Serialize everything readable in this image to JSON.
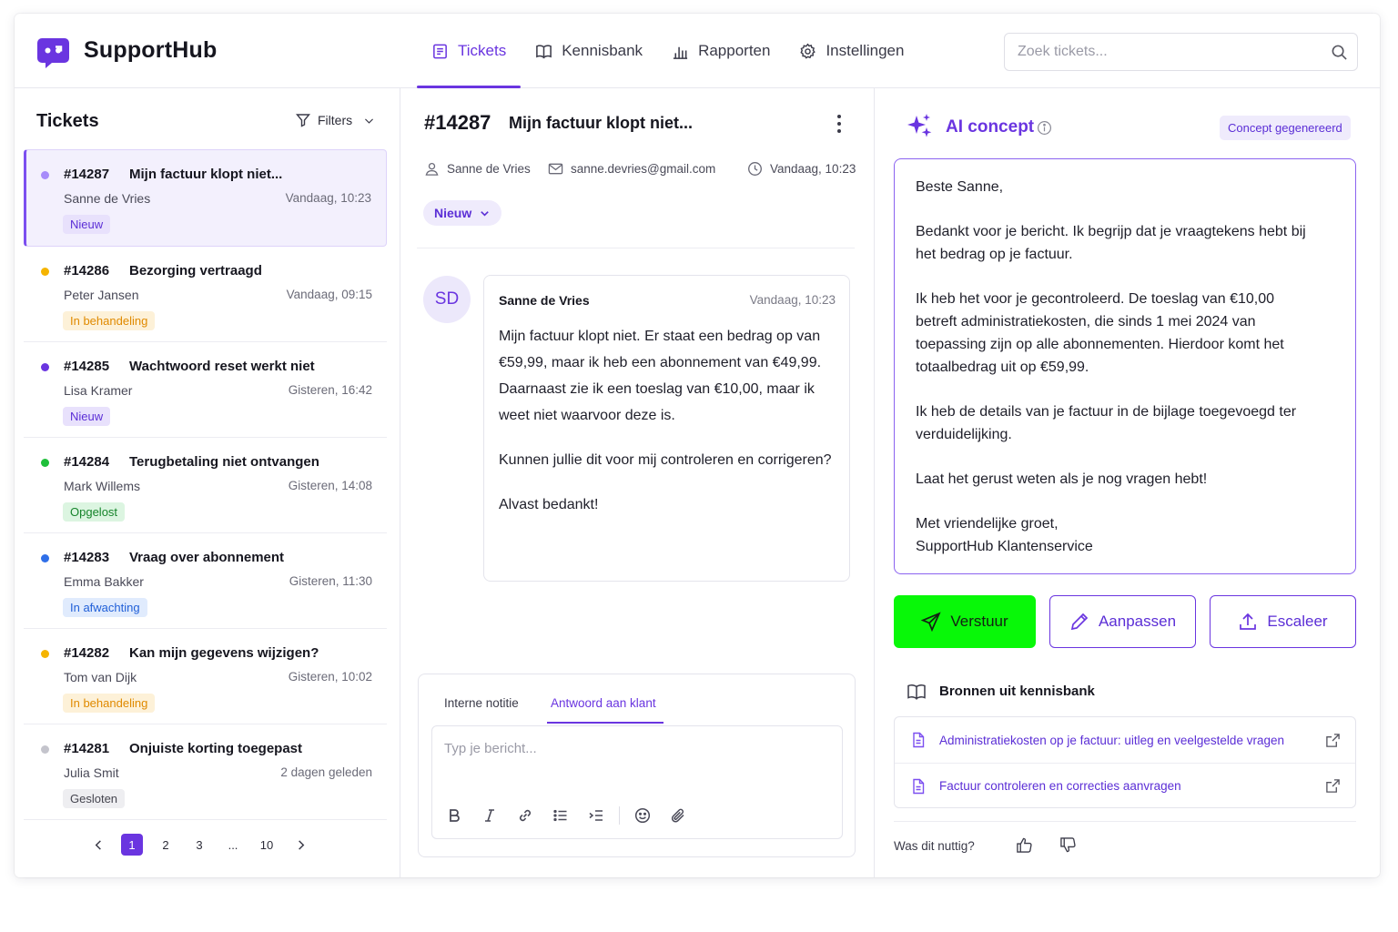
{
  "app": {
    "brand": "SupportHub"
  },
  "nav": {
    "items": [
      {
        "label": "Tickets",
        "icon": "ticket-icon",
        "active": true
      },
      {
        "label": "Kennisbank",
        "icon": "book-icon"
      },
      {
        "label": "Rapporten",
        "icon": "bar-chart-icon"
      },
      {
        "label": "Instellingen",
        "icon": "gear-icon"
      }
    ]
  },
  "search": {
    "placeholder": "Zoek tickets..."
  },
  "ticket_list": {
    "title": "Tickets",
    "filters_label": "Filters",
    "tickets": [
      {
        "id": "#14287",
        "title": "Mijn factuur klopt niet...",
        "name": "Sanne de Vries",
        "time": "Vandaag, 10:23",
        "status": "Nieuw",
        "dot": "#a78bfa",
        "badge_bg": "#e8e1fc",
        "badge_fg": "#5b2ed6"
      },
      {
        "id": "#14286",
        "title": "Bezorging vertraagd",
        "name": "Peter Jansen",
        "time": "Vandaag, 09:15",
        "status": "In behandeling",
        "dot": "#f5b400",
        "badge_bg": "#fdf1d8",
        "badge_fg": "#e08a00"
      },
      {
        "id": "#14285",
        "title": "Wachtwoord reset werkt niet",
        "name": "Lisa Kramer",
        "time": "Gisteren, 16:42",
        "status": "Nieuw",
        "dot": "#6a35e0",
        "badge_bg": "#e8e1fc",
        "badge_fg": "#5b2ed6"
      },
      {
        "id": "#14284",
        "title": "Terugbetaling niet ontvangen",
        "name": "Mark Willems",
        "time": "Gisteren, 14:08",
        "status": "Opgelost",
        "dot": "#1fbf3a",
        "badge_bg": "#dcf5e1",
        "badge_fg": "#16842b"
      },
      {
        "id": "#14283",
        "title": "Vraag over abonnement",
        "name": "Emma Bakker",
        "time": "Gisteren, 11:30",
        "status": "In afwachting",
        "dot": "#2f6fe8",
        "badge_bg": "#e0ebfd",
        "badge_fg": "#2160d8"
      },
      {
        "id": "#14282",
        "title": "Kan mijn gegevens wijzigen?",
        "name": "Tom van Dijk",
        "time": "Gisteren, 10:02",
        "status": "In behandeling",
        "dot": "#f5b400",
        "badge_bg": "#fdf1d8",
        "badge_fg": "#e08a00"
      },
      {
        "id": "#14281",
        "title": "Onjuiste korting toegepast",
        "name": "Julia Smit",
        "time": "2 dagen geleden",
        "status": "Gesloten",
        "dot": "#c4c4cc",
        "badge_bg": "#eeeef1",
        "badge_fg": "#45454f"
      }
    ],
    "pagination": {
      "pages": [
        "1",
        "2",
        "3",
        "...",
        "10"
      ],
      "current": "1"
    }
  },
  "ticket_detail": {
    "id": "#14287",
    "title": "Mijn factuur klopt niet...",
    "customer": "Sanne de Vries",
    "email": "sanne.devries@gmail.com",
    "time": "Vandaag, 10:23",
    "status": "Nieuw",
    "message": {
      "initials": "SD",
      "author": "Sanne de Vries",
      "time": "Vandaag, 10:23",
      "paragraphs": [
        "Mijn factuur klopt niet. Er staat een bedrag op van €59,99, maar ik heb een abonnement van €49,99. Daarnaast zie ik een toeslag van €10,00, maar ik weet niet waarvoor deze is.",
        "Kunnen jullie dit voor mij controleren en corrigeren?",
        "Alvast bedankt!"
      ]
    },
    "composer": {
      "tabs": [
        "Interne notitie",
        "Antwoord aan klant"
      ],
      "active_tab": "Antwoord aan klant",
      "placeholder": "Typ je bericht..."
    }
  },
  "ai_panel": {
    "title": "AI concept",
    "badge": "Concept gegenereerd",
    "draft": [
      "Beste Sanne,",
      "Bedankt voor je bericht. Ik begrijp dat je vraagtekens hebt bij het bedrag op je factuur.",
      "Ik heb het voor je gecontroleerd. De toeslag van €10,00 betreft administratiekosten, die sinds 1 mei 2024 van toepassing zijn op alle abonnementen. Hierdoor komt het totaalbedrag uit op €59,99.",
      "Ik heb de details van je factuur in de bijlage toegevoegd ter verduidelijking.",
      "Laat het gerust weten als je nog vragen hebt!",
      "Met vriendelijke groet,",
      "SupportHub Klantenservice"
    ],
    "buttons": {
      "send": "Verstuur",
      "edit": "Aanpassen",
      "escalate": "Escaleer"
    },
    "sources_title": "Bronnen uit kennisbank",
    "sources": [
      "Administratiekosten op je factuur: uitleg en veelgestelde vragen",
      "Factuur controleren en correcties aanvragen"
    ],
    "feedback_question": "Was dit nuttig?"
  },
  "colors": {
    "accent": "#6a35e0",
    "send_button": "#08f808"
  }
}
